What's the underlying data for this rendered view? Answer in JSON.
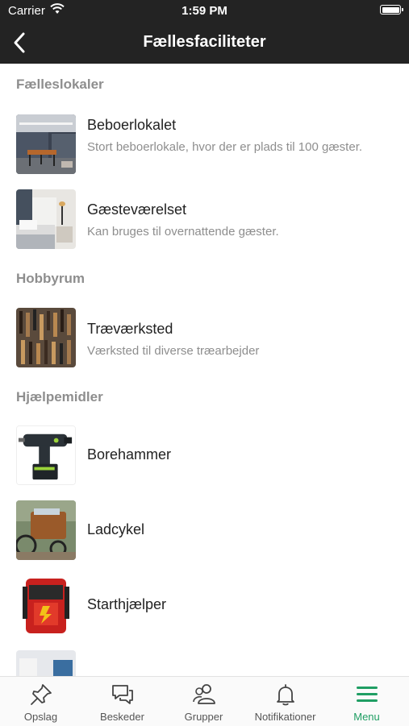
{
  "status_bar": {
    "carrier": "Carrier",
    "time": "1:59 PM"
  },
  "nav": {
    "title": "Fællesfaciliteter",
    "back_icon": "chevron-left-icon"
  },
  "sections": [
    {
      "title": "Fælleslokaler",
      "items": [
        {
          "name": "Beboerlokalet",
          "description": "Stort beboerlokale, hvor der er plads til 100 gæster."
        },
        {
          "name": "Gæsteværelset",
          "description": "Kan bruges til overnattende gæster."
        }
      ]
    },
    {
      "title": "Hobbyrum",
      "items": [
        {
          "name": "Træværksted",
          "description": "Værksted til diverse træarbejder"
        }
      ]
    },
    {
      "title": "Hjælpemidler",
      "items": [
        {
          "name": "Borehammer"
        },
        {
          "name": "Ladcykel"
        },
        {
          "name": "Starthjælper"
        }
      ]
    }
  ],
  "tab_bar": {
    "accent_color": "#1f9e63",
    "tabs": [
      {
        "label": "Opslag",
        "icon": "pin-icon"
      },
      {
        "label": "Beskeder",
        "icon": "chat-icon"
      },
      {
        "label": "Grupper",
        "icon": "users-icon"
      },
      {
        "label": "Notifikationer",
        "icon": "bell-icon"
      },
      {
        "label": "Menu",
        "icon": "menu-icon",
        "active": true
      }
    ]
  }
}
